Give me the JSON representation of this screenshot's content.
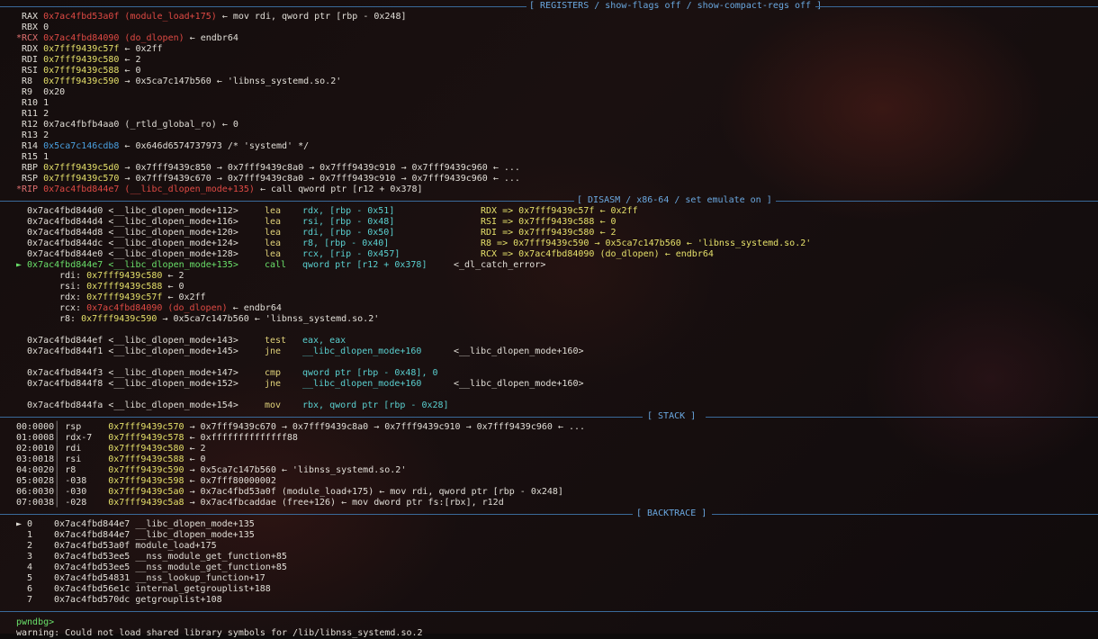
{
  "sections": {
    "registers": "[ REGISTERS / show-flags off / show-compact-regs off ]",
    "disasm": "[ DISASM / x86-64 / set emulate on ]",
    "stack": "[ STACK ]",
    "backtrace": "[ BACKTRACE ]"
  },
  "registers": [
    {
      "name": " RAX",
      "val": "0x7ac4fbd53a0f (module_load+175)",
      "rest": " ← mov rdi, qword ptr [rbp - 0x248]"
    },
    {
      "name": " RBX",
      "val": "0",
      "rest": ""
    },
    {
      "name": "*RCX",
      "val": "0x7ac4fbd84090 (do_dlopen)",
      "rest": " ← endbr64"
    },
    {
      "name": " RDX",
      "val": "0x7fff9439c57f",
      "rest": " ← 0x2ff"
    },
    {
      "name": " RDI",
      "val": "0x7fff9439c580",
      "rest": " ← 2"
    },
    {
      "name": " RSI",
      "val": "0x7fff9439c588",
      "rest": " ← 0"
    },
    {
      "name": " R8",
      "val": "0x7fff9439c590",
      "rest": " → 0x5ca7c147b560 ← 'libnss_systemd.so.2'"
    },
    {
      "name": " R9",
      "val": "0x20",
      "rest": ""
    },
    {
      "name": " R10",
      "val": "1",
      "rest": ""
    },
    {
      "name": " R11",
      "val": "2",
      "rest": ""
    },
    {
      "name": " R12",
      "val": "0x7ac4fbfb4aa0 (_rtld_global_ro)",
      "rest": " ← 0"
    },
    {
      "name": " R13",
      "val": "2",
      "rest": ""
    },
    {
      "name": " R14",
      "val": "0x5ca7c146cdb8",
      "rest": " ← 0x646d6574737973 /* 'systemd' */"
    },
    {
      "name": " R15",
      "val": "1",
      "rest": ""
    },
    {
      "name": " RBP",
      "val": "0x7fff9439c5d0",
      "rest": " → 0x7fff9439c850 → 0x7fff9439c8a0 → 0x7fff9439c910 → 0x7fff9439c960 ← ..."
    },
    {
      "name": " RSP",
      "val": "0x7fff9439c570",
      "rest": " → 0x7fff9439c670 → 0x7fff9439c8a0 → 0x7fff9439c910 → 0x7fff9439c960 ← ..."
    },
    {
      "name": "*RIP",
      "val": "0x7ac4fbd844e7 (__libc_dlopen_mode+135)",
      "rest": " ← call qword ptr [r12 + 0x378]"
    }
  ],
  "disasm": [
    {
      "addr": "0x7ac4fbd844d0",
      "sym": "<__libc_dlopen_mode+112>",
      "mn": "lea",
      "op": "rdx, [rbp - 0x51]",
      "ann": "RDX => 0x7fff9439c57f ← 0x2ff"
    },
    {
      "addr": "0x7ac4fbd844d4",
      "sym": "<__libc_dlopen_mode+116>",
      "mn": "lea",
      "op": "rsi, [rbp - 0x48]",
      "ann": "RSI => 0x7fff9439c588 ← 0"
    },
    {
      "addr": "0x7ac4fbd844d8",
      "sym": "<__libc_dlopen_mode+120>",
      "mn": "lea",
      "op": "rdi, [rbp - 0x50]",
      "ann": "RDI => 0x7fff9439c580 ← 2"
    },
    {
      "addr": "0x7ac4fbd844dc",
      "sym": "<__libc_dlopen_mode+124>",
      "mn": "lea",
      "op": "r8, [rbp - 0x40]",
      "ann": "R8 => 0x7fff9439c590 → 0x5ca7c147b560 ← 'libnss_systemd.so.2'"
    },
    {
      "addr": "0x7ac4fbd844e0",
      "sym": "<__libc_dlopen_mode+128>",
      "mn": "lea",
      "op": "rcx, [rip - 0x457]",
      "ann": "RCX => 0x7ac4fbd84090 (do_dlopen) ← endbr64"
    },
    {
      "addr": "0x7ac4fbd844e7",
      "sym": "<__libc_dlopen_mode+135>",
      "mn": "call",
      "op": "qword ptr [r12 + 0x378]",
      "ann": "<_dl_catch_error>"
    }
  ],
  "args": [
    {
      "reg": "rdi:",
      "val": "0x7fff9439c580",
      "rest": " ← 2"
    },
    {
      "reg": "rsi:",
      "val": "0x7fff9439c588",
      "rest": " ← 0"
    },
    {
      "reg": "rdx:",
      "val": "0x7fff9439c57f",
      "rest": " ← 0x2ff"
    },
    {
      "reg": "rcx:",
      "val": "0x7ac4fbd84090 (do_dlopen)",
      "rest": " ← endbr64"
    },
    {
      "reg": "r8:",
      "val": "0x7fff9439c590",
      "rest": " → 0x5ca7c147b560 ← 'libnss_systemd.so.2'"
    }
  ],
  "disasm2": [
    {
      "addr": "0x7ac4fbd844ef",
      "sym": "<__libc_dlopen_mode+143>",
      "mn": "test",
      "op": "eax, eax",
      "ann": ""
    },
    {
      "addr": "0x7ac4fbd844f1",
      "sym": "<__libc_dlopen_mode+145>",
      "mn": "jne",
      "op": "__libc_dlopen_mode+160",
      "ann": "<__libc_dlopen_mode+160>"
    },
    {
      "addr": "0x7ac4fbd844f3",
      "sym": "<__libc_dlopen_mode+147>",
      "mn": "cmp",
      "op": "qword ptr [rbp - 0x48], 0",
      "ann": ""
    },
    {
      "addr": "0x7ac4fbd844f8",
      "sym": "<__libc_dlopen_mode+152>",
      "mn": "jne",
      "op": "__libc_dlopen_mode+160",
      "ann": "<__libc_dlopen_mode+160>"
    },
    {
      "addr": "0x7ac4fbd844fa",
      "sym": "<__libc_dlopen_mode+154>",
      "mn": "mov",
      "op": "rbx, qword ptr [rbp - 0x28]",
      "ann": ""
    }
  ],
  "stack": [
    {
      "off": "00:0000",
      "reg": "rsp",
      "val": "0x7fff9439c570",
      "rest": " → 0x7fff9439c670 → 0x7fff9439c8a0 → 0x7fff9439c910 → 0x7fff9439c960 ← ..."
    },
    {
      "off": "01:0008",
      "reg": "rdx-7",
      "val": "0x7fff9439c578",
      "rest": " ← 0xffffffffffffff88"
    },
    {
      "off": "02:0010",
      "reg": "rdi",
      "val": "0x7fff9439c580",
      "rest": " ← 2"
    },
    {
      "off": "03:0018",
      "reg": "rsi",
      "val": "0x7fff9439c588",
      "rest": " ← 0"
    },
    {
      "off": "04:0020",
      "reg": "r8",
      "val": "0x7fff9439c590",
      "rest": " → 0x5ca7c147b560 ← 'libnss_systemd.so.2'"
    },
    {
      "off": "05:0028",
      "reg": "-038",
      "val": "0x7fff9439c598",
      "rest": " ← 0x7fff80000002"
    },
    {
      "off": "06:0030",
      "reg": "-030",
      "val": "0x7fff9439c5a0",
      "rest": " → 0x7ac4fbd53a0f (module_load+175) ← mov rdi, qword ptr [rbp - 0x248]"
    },
    {
      "off": "07:0038",
      "reg": "-028",
      "val": "0x7fff9439c5a8",
      "rest": " → 0x7ac4fbcaddae (free+126) ← mov dword ptr fs:[rbx], r12d"
    }
  ],
  "backtrace": [
    {
      "idx": "► 0",
      "addr": "0x7ac4fbd844e7",
      "sym": "__libc_dlopen_mode+135"
    },
    {
      "idx": "  1",
      "addr": "0x7ac4fbd844e7",
      "sym": "__libc_dlopen_mode+135"
    },
    {
      "idx": "  2",
      "addr": "0x7ac4fbd53a0f",
      "sym": "module_load+175"
    },
    {
      "idx": "  3",
      "addr": "0x7ac4fbd53ee5",
      "sym": "__nss_module_get_function+85"
    },
    {
      "idx": "  4",
      "addr": "0x7ac4fbd53ee5",
      "sym": "__nss_module_get_function+85"
    },
    {
      "idx": "  5",
      "addr": "0x7ac4fbd54831",
      "sym": "__nss_lookup_function+17"
    },
    {
      "idx": "  6",
      "addr": "0x7ac4fbd56e1c",
      "sym": "internal_getgrouplist+188"
    },
    {
      "idx": "  7",
      "addr": "0x7ac4fbd570dc",
      "sym": "getgrouplist+108"
    }
  ],
  "prompt": "pwndbg>",
  "warning": "warning: Could not load shared library symbols for /lib/libnss_systemd.so.2"
}
